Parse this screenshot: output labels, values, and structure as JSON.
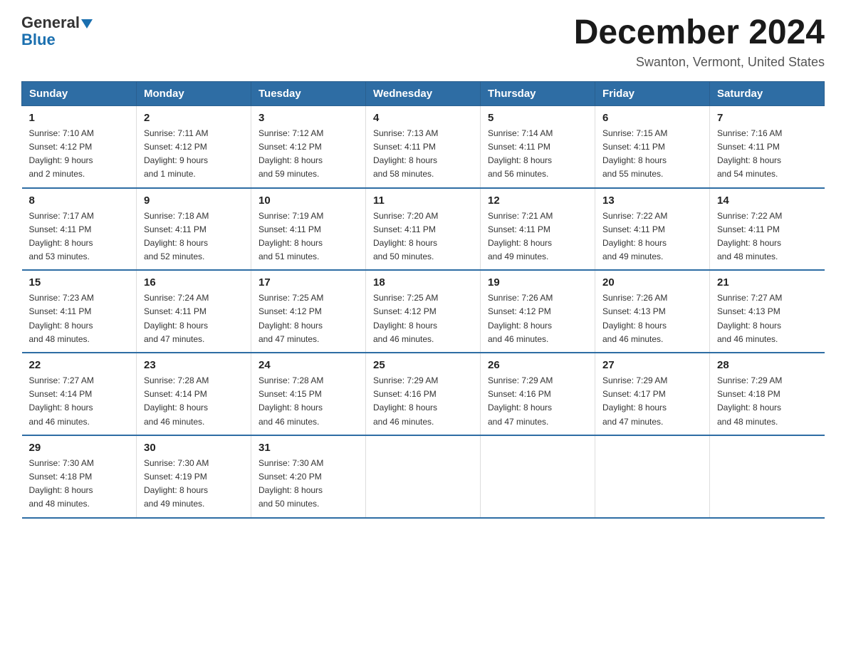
{
  "header": {
    "logo_general": "General",
    "logo_blue": "Blue",
    "month_title": "December 2024",
    "location": "Swanton, Vermont, United States"
  },
  "weekdays": [
    "Sunday",
    "Monday",
    "Tuesday",
    "Wednesday",
    "Thursday",
    "Friday",
    "Saturday"
  ],
  "weeks": [
    [
      {
        "day": "1",
        "sunrise": "7:10 AM",
        "sunset": "4:12 PM",
        "daylight": "9 hours and 2 minutes."
      },
      {
        "day": "2",
        "sunrise": "7:11 AM",
        "sunset": "4:12 PM",
        "daylight": "9 hours and 1 minute."
      },
      {
        "day": "3",
        "sunrise": "7:12 AM",
        "sunset": "4:12 PM",
        "daylight": "8 hours and 59 minutes."
      },
      {
        "day": "4",
        "sunrise": "7:13 AM",
        "sunset": "4:11 PM",
        "daylight": "8 hours and 58 minutes."
      },
      {
        "day": "5",
        "sunrise": "7:14 AM",
        "sunset": "4:11 PM",
        "daylight": "8 hours and 56 minutes."
      },
      {
        "day": "6",
        "sunrise": "7:15 AM",
        "sunset": "4:11 PM",
        "daylight": "8 hours and 55 minutes."
      },
      {
        "day": "7",
        "sunrise": "7:16 AM",
        "sunset": "4:11 PM",
        "daylight": "8 hours and 54 minutes."
      }
    ],
    [
      {
        "day": "8",
        "sunrise": "7:17 AM",
        "sunset": "4:11 PM",
        "daylight": "8 hours and 53 minutes."
      },
      {
        "day": "9",
        "sunrise": "7:18 AM",
        "sunset": "4:11 PM",
        "daylight": "8 hours and 52 minutes."
      },
      {
        "day": "10",
        "sunrise": "7:19 AM",
        "sunset": "4:11 PM",
        "daylight": "8 hours and 51 minutes."
      },
      {
        "day": "11",
        "sunrise": "7:20 AM",
        "sunset": "4:11 PM",
        "daylight": "8 hours and 50 minutes."
      },
      {
        "day": "12",
        "sunrise": "7:21 AM",
        "sunset": "4:11 PM",
        "daylight": "8 hours and 49 minutes."
      },
      {
        "day": "13",
        "sunrise": "7:22 AM",
        "sunset": "4:11 PM",
        "daylight": "8 hours and 49 minutes."
      },
      {
        "day": "14",
        "sunrise": "7:22 AM",
        "sunset": "4:11 PM",
        "daylight": "8 hours and 48 minutes."
      }
    ],
    [
      {
        "day": "15",
        "sunrise": "7:23 AM",
        "sunset": "4:11 PM",
        "daylight": "8 hours and 48 minutes."
      },
      {
        "day": "16",
        "sunrise": "7:24 AM",
        "sunset": "4:11 PM",
        "daylight": "8 hours and 47 minutes."
      },
      {
        "day": "17",
        "sunrise": "7:25 AM",
        "sunset": "4:12 PM",
        "daylight": "8 hours and 47 minutes."
      },
      {
        "day": "18",
        "sunrise": "7:25 AM",
        "sunset": "4:12 PM",
        "daylight": "8 hours and 46 minutes."
      },
      {
        "day": "19",
        "sunrise": "7:26 AM",
        "sunset": "4:12 PM",
        "daylight": "8 hours and 46 minutes."
      },
      {
        "day": "20",
        "sunrise": "7:26 AM",
        "sunset": "4:13 PM",
        "daylight": "8 hours and 46 minutes."
      },
      {
        "day": "21",
        "sunrise": "7:27 AM",
        "sunset": "4:13 PM",
        "daylight": "8 hours and 46 minutes."
      }
    ],
    [
      {
        "day": "22",
        "sunrise": "7:27 AM",
        "sunset": "4:14 PM",
        "daylight": "8 hours and 46 minutes."
      },
      {
        "day": "23",
        "sunrise": "7:28 AM",
        "sunset": "4:14 PM",
        "daylight": "8 hours and 46 minutes."
      },
      {
        "day": "24",
        "sunrise": "7:28 AM",
        "sunset": "4:15 PM",
        "daylight": "8 hours and 46 minutes."
      },
      {
        "day": "25",
        "sunrise": "7:29 AM",
        "sunset": "4:16 PM",
        "daylight": "8 hours and 46 minutes."
      },
      {
        "day": "26",
        "sunrise": "7:29 AM",
        "sunset": "4:16 PM",
        "daylight": "8 hours and 47 minutes."
      },
      {
        "day": "27",
        "sunrise": "7:29 AM",
        "sunset": "4:17 PM",
        "daylight": "8 hours and 47 minutes."
      },
      {
        "day": "28",
        "sunrise": "7:29 AM",
        "sunset": "4:18 PM",
        "daylight": "8 hours and 48 minutes."
      }
    ],
    [
      {
        "day": "29",
        "sunrise": "7:30 AM",
        "sunset": "4:18 PM",
        "daylight": "8 hours and 48 minutes."
      },
      {
        "day": "30",
        "sunrise": "7:30 AM",
        "sunset": "4:19 PM",
        "daylight": "8 hours and 49 minutes."
      },
      {
        "day": "31",
        "sunrise": "7:30 AM",
        "sunset": "4:20 PM",
        "daylight": "8 hours and 50 minutes."
      },
      null,
      null,
      null,
      null
    ]
  ],
  "labels": {
    "sunrise": "Sunrise:",
    "sunset": "Sunset:",
    "daylight": "Daylight:"
  }
}
